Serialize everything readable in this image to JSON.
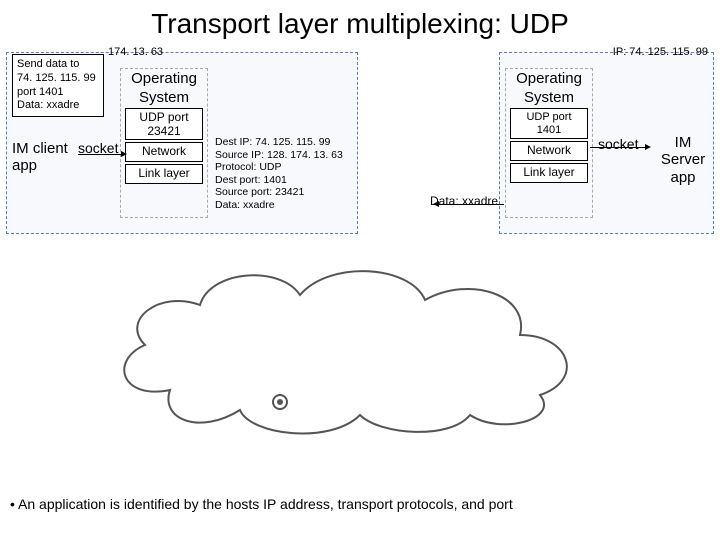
{
  "title": "Transport layer multiplexing: UDP",
  "left_host": {
    "ip_label": "174. 13. 63",
    "send": {
      "l1": "Send data to",
      "l2": "74. 125. 115. 99",
      "l3": "port 1401",
      "l4": "Data: xxadre"
    },
    "os": {
      "title_l1": "Operating",
      "title_l2": "System",
      "udp_l1": "UDP port",
      "udp_l2": "23421",
      "net": "Network",
      "link": "Link layer"
    },
    "app_l1": "IM client",
    "app_l2": "app",
    "socket": "socket"
  },
  "packet": {
    "l1": "Dest IP: 74. 125. 115. 99",
    "l2": "Source IP: 128. 174. 13. 63",
    "l3": "Protocol: UDP",
    "l4": "Dest port: 1401",
    "l5": "Source port: 23421",
    "l6": "Data: xxadre"
  },
  "right_host": {
    "ip_label": "IP: 74. 125. 115. 99",
    "os": {
      "title_l1": "Operating",
      "title_l2": "System",
      "udp": "UDP port 1401",
      "net": "Network",
      "link": "Link layer"
    },
    "app_l1": "IM",
    "app_l2": "Server",
    "app_l3": "app",
    "socket": "socket",
    "data": "Data: xxadre"
  },
  "bullet": "• An application is identified by the hosts IP address, transport protocols, and port"
}
